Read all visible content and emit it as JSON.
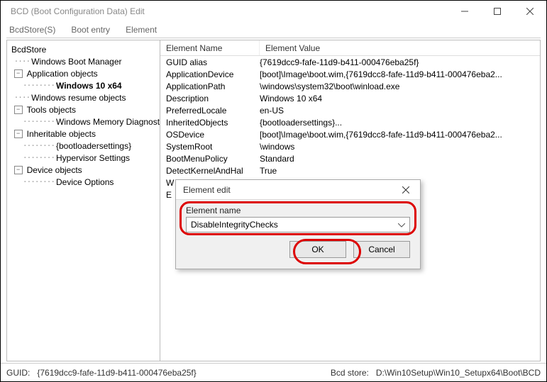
{
  "window": {
    "title": "BCD (Boot Configuration Data) Edit"
  },
  "menu": {
    "items": [
      "BcdStore(S)",
      "Boot entry",
      "Element"
    ]
  },
  "tree": {
    "root": "BcdStore",
    "nodes": [
      {
        "label": "Windows Boot Manager",
        "indent": 1,
        "expander": "",
        "bold": false
      },
      {
        "label": "Application objects",
        "indent": 1,
        "expander": "−",
        "bold": false
      },
      {
        "label": "Windows 10 x64",
        "indent": 2,
        "expander": "",
        "bold": true
      },
      {
        "label": "Windows resume objects",
        "indent": 1,
        "expander": "",
        "bold": false
      },
      {
        "label": "Tools objects",
        "indent": 1,
        "expander": "−",
        "bold": false
      },
      {
        "label": "Windows Memory Diagnostic",
        "indent": 2,
        "expander": "",
        "bold": false
      },
      {
        "label": "Inheritable objects",
        "indent": 1,
        "expander": "−",
        "bold": false
      },
      {
        "label": "{bootloadersettings}",
        "indent": 2,
        "expander": "",
        "bold": false
      },
      {
        "label": "Hypervisor Settings",
        "indent": 2,
        "expander": "",
        "bold": false
      },
      {
        "label": "Device objects",
        "indent": 1,
        "expander": "−",
        "bold": false
      },
      {
        "label": "Device Options",
        "indent": 2,
        "expander": "",
        "bold": false
      }
    ]
  },
  "list": {
    "headers": {
      "name": "Element Name",
      "value": "Element Value"
    },
    "rows": [
      {
        "name": "GUID alias",
        "value": "{7619dcc9-fafe-11d9-b411-000476eba25f}"
      },
      {
        "name": "ApplicationDevice",
        "value": "[boot]\\Image\\boot.wim,{7619dcc8-fafe-11d9-b411-000476eba2..."
      },
      {
        "name": "ApplicationPath",
        "value": "\\windows\\system32\\boot\\winload.exe"
      },
      {
        "name": "Description",
        "value": "Windows 10 x64"
      },
      {
        "name": "PreferredLocale",
        "value": "en-US"
      },
      {
        "name": "InheritedObjects",
        "value": "{bootloadersettings}..."
      },
      {
        "name": "OSDevice",
        "value": "[boot]\\Image\\boot.wim,{7619dcc8-fafe-11d9-b411-000476eba2..."
      },
      {
        "name": "SystemRoot",
        "value": "\\windows"
      },
      {
        "name": "BootMenuPolicy",
        "value": "Standard"
      },
      {
        "name": "DetectKernelAndHal",
        "value": "True"
      },
      {
        "name": "W",
        "value": ""
      },
      {
        "name": "E",
        "value": ""
      }
    ]
  },
  "dialog": {
    "title": "Element edit",
    "label": "Element name",
    "combo_value": "DisableIntegrityChecks",
    "ok": "OK",
    "cancel": "Cancel"
  },
  "status": {
    "guid_label": "GUID:",
    "guid_value": "{7619dcc9-fafe-11d9-b411-000476eba25f}",
    "store_label": "Bcd store:",
    "store_value": "D:\\Win10Setup\\Win10_Setupx64\\Boot\\BCD"
  }
}
